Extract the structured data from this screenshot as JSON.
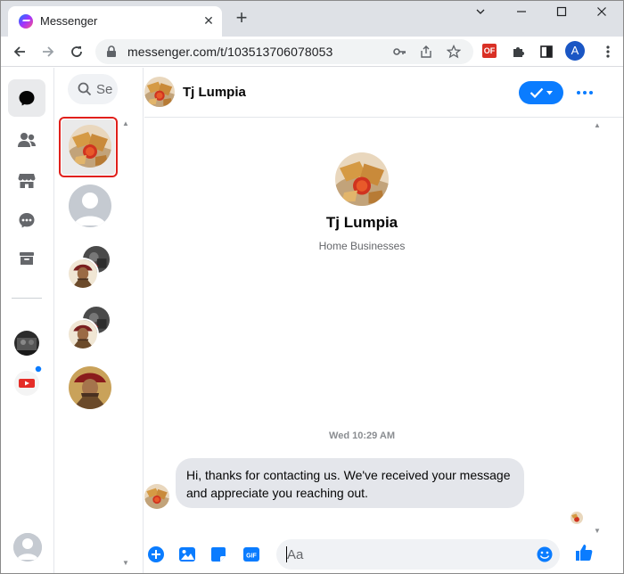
{
  "browser": {
    "tab_title": "Messenger",
    "tab_close": "✕",
    "new_tab": "+",
    "url": "messenger.com/t/103513706078053",
    "ext_badge": "OF",
    "profile_initial": "A"
  },
  "chat_list": {
    "search_placeholder": "Se"
  },
  "conversation": {
    "contact_name": "Tj Lumpia",
    "contact_subtitle": "Home Businesses",
    "timestamp": "Wed 10:29 AM",
    "message": "Hi, thanks for contacting us. We've received your message and appreciate you reaching out.",
    "composer_placeholder": "Aa"
  },
  "colors": {
    "accent": "#0a7cff",
    "selection_outline": "#e0201b"
  }
}
